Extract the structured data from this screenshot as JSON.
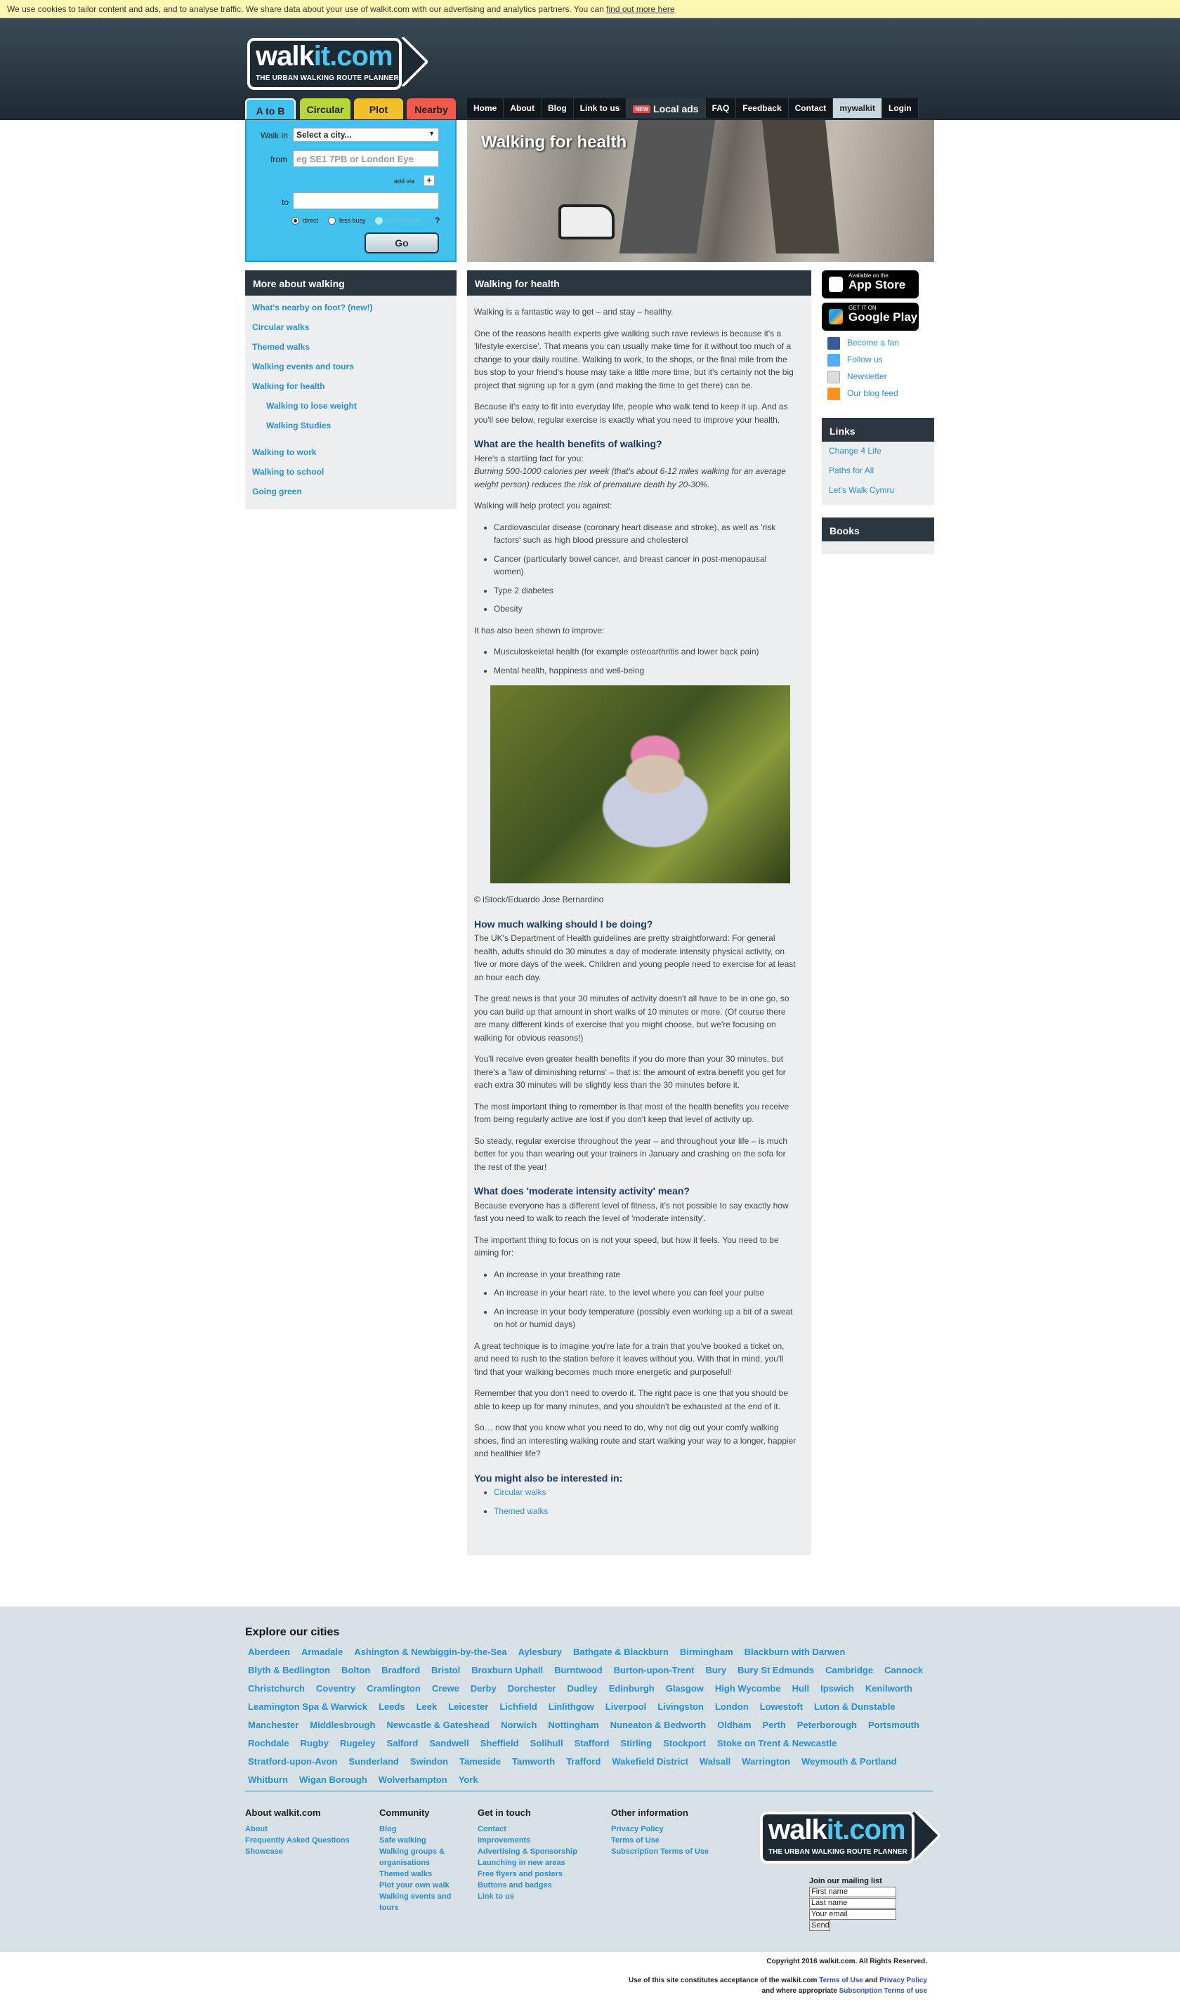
{
  "cookie": {
    "text": "We use cookies to tailor content and ads, and to analyse traffic. We share data about your use of walkit.com with our advertising and analytics partners. You can",
    "link": "find out more here"
  },
  "logo": {
    "walk": "walk",
    "it": "it.com",
    "tagline": "THE URBAN WALKING ROUTE PLANNER"
  },
  "tabs": [
    {
      "label": "A to B",
      "color": "#41c2ef"
    },
    {
      "label": "Circular",
      "color": "#b8d63a"
    },
    {
      "label": "Plot",
      "color": "#f4c02a"
    },
    {
      "label": "Nearby",
      "color": "#f05a4c"
    }
  ],
  "nav": {
    "home": "Home",
    "about": "About",
    "blog": "Blog",
    "link": "Link to us",
    "new_badge": "NEW",
    "local_ads": "Local ads",
    "faq": "FAQ",
    "feedback": "Feedback",
    "contact": "Contact",
    "mywalkit": "mywalkit",
    "login": "Login"
  },
  "planner": {
    "walk_in": "Walk in",
    "city_select": "Select a city...",
    "from": "from",
    "from_placeholder": "eg SE1 7PB or London Eye",
    "add_via": "add via",
    "to": "to",
    "opt_direct": "direct",
    "opt_less_busy": "less busy",
    "opt_low_pollution": "low pollution",
    "help": "?",
    "go": "Go"
  },
  "hero": {
    "title": "Walking for health"
  },
  "left": {
    "heading": "More about walking",
    "items": [
      "What's nearby on foot? (new!)",
      "Circular walks",
      "Themed walks",
      "Walking events and tours",
      "Walking for health"
    ],
    "subitems": [
      "Walking to lose weight",
      "Walking Studies"
    ],
    "items2": [
      "Walking to work",
      "Walking to school",
      "Going green"
    ]
  },
  "article": {
    "heading": "Walking for health",
    "p1": "Walking is a fantastic way to get – and stay – healthy.",
    "p2": "One of the reasons health experts give walking such rave reviews is because it's a 'lifestyle exercise'. That means you can usually make time for it without too much of a change to your daily routine. Walking to work, to the shops, or the final mile from the bus stop to your friend's house may take a little more time, but it's certainly not the big project that signing up for a gym (and making the time to get there) can be.",
    "p3": "Because it's easy to fit into everyday life, people who walk tend to keep it up. And as you'll see below, regular exercise is exactly what you need to improve your health.",
    "h1": "What are the health benefits of walking?",
    "p4a": "Here's a startling fact for you:",
    "p4b": "Burning 500-1000 calories per week (that's about 6-12 miles walking for an average weight person) reduces the risk of premature death by 20-30%.",
    "p5": "Walking will help protect you against:",
    "list1": [
      "Cardiovascular disease (coronary heart disease and stroke), as well as 'risk factors' such as high blood pressure and cholesterol",
      "Cancer (particularly bowel cancer, and breast cancer in post-menopausal women)",
      "Type 2 diabetes",
      "Obesity"
    ],
    "p6": "It has also been shown to improve:",
    "list2": [
      "Musculoskeletal health (for example osteoarthritis and lower back pain)",
      "Mental health, happiness and well-being"
    ],
    "caption": "© iStock/Eduardo Jose Bernardino",
    "h2": "How much walking should I be doing?",
    "p7": "The UK's Department of Health guidelines are pretty straightforward: For general health, adults should do 30 minutes a day of moderate intensity physical activity, on five or more days of the week. Children and young people need to exercise for at least an hour each day.",
    "p8": "The great news is that your 30 minutes of activity doesn't all have to be in one go, so you can build up that amount in short walks of 10 minutes or more. (Of course there are many different kinds of exercise that you might choose, but we're focusing on walking for obvious reasons!)",
    "p9": "You'll receive even greater health benefits if you do more than your 30 minutes, but there's a 'law of diminishing returns' – that is: the amount of extra benefit you get for each extra 30 minutes will be slightly less than the 30 minutes before it.",
    "p10": "The most important thing to remember is that most of the health benefits you receive from being regularly active are lost if you don't keep that level of activity up.",
    "p11": "So steady, regular exercise throughout the year – and throughout your life – is much better for you than wearing out your trainers in January and crashing on the sofa for the rest of the year!",
    "h3": "What does 'moderate intensity activity' mean?",
    "p12": "Because everyone has a different level of fitness, it's not possible to say exactly how fast you need to walk to reach the level of 'moderate intensity'.",
    "p13": "The important thing to focus on is not your speed, but how it feels. You need to be aiming for:",
    "list3": [
      "An increase in your breathing rate",
      "An increase in your heart rate, to the level where you can feel your pulse",
      "An increase in your body temperature (possibly even working up a bit of a sweat on hot or humid days)"
    ],
    "p14": "A great technique is to imagine you're late for a train that you've booked a ticket on, and need to rush to the station before it leaves without you. With that in mind, you'll find that your walking becomes much more energetic and purposeful!",
    "p15": "Remember that you don't need to overdo it. The right pace is one that you should be able to keep up for many minutes, and you shouldn't be exhausted at the end of it.",
    "p16": "So… now that you know what you need to do, why not dig out your comfy walking shoes, find an interesting walking route and start walking your way to a longer, happier and healthier life?",
    "h4": "You might also be interested in:",
    "list4": [
      "Circular walks",
      "Themed walks"
    ]
  },
  "right": {
    "appstore_small": "Available on the",
    "appstore_big": "App Store",
    "play_small": "GET IT ON",
    "play_big": "Google Play",
    "social": [
      "Become a fan",
      "Follow us",
      "Newsletter",
      "Our blog feed"
    ],
    "links_heading": "Links",
    "links": [
      "Change 4 Life",
      "Paths for All",
      "Let's Walk Cymru"
    ],
    "books_heading": "Books"
  },
  "footer": {
    "cities_heading": "Explore our cities",
    "cities": [
      "Aberdeen",
      "Armadale",
      "Ashington & Newbiggin-by-the-Sea",
      "Aylesbury",
      "Bathgate & Blackburn",
      "Birmingham",
      "Blackburn with Darwen",
      "Blyth & Bedlington",
      "Bolton",
      "Bradford",
      "Bristol",
      "Broxburn Uphall",
      "Burntwood",
      "Burton-upon-Trent",
      "Bury",
      "Bury St Edmunds",
      "Cambridge",
      "Cannock",
      "Christchurch",
      "Coventry",
      "Cramlington",
      "Crewe",
      "Derby",
      "Dorchester",
      "Dudley",
      "Edinburgh",
      "Glasgow",
      "High Wycombe",
      "Hull",
      "Ipswich",
      "Kenilworth",
      "Leamington Spa & Warwick",
      "Leeds",
      "Leek",
      "Leicester",
      "Lichfield",
      "Linlithgow",
      "Liverpool",
      "Livingston",
      "London",
      "Lowestoft",
      "Luton & Dunstable",
      "Manchester",
      "Middlesbrough",
      "Newcastle & Gateshead",
      "Norwich",
      "Nottingham",
      "Nuneaton & Bedworth",
      "Oldham",
      "Perth",
      "Peterborough",
      "Portsmouth",
      "Rochdale",
      "Rugby",
      "Rugeley",
      "Salford",
      "Sandwell",
      "Sheffield",
      "Solihull",
      "Stafford",
      "Stirling",
      "Stockport",
      "Stoke on Trent & Newcastle",
      "Stratford-upon-Avon",
      "Sunderland",
      "Swindon",
      "Tameside",
      "Tamworth",
      "Trafford",
      "Wakefield District",
      "Walsall",
      "Warrington",
      "Weymouth & Portland",
      "Whitburn",
      "Wigan Borough",
      "Wolverhampton",
      "York"
    ],
    "about_heading": "About walkit.com",
    "about": [
      "About",
      "Frequently Asked Questions",
      "Showcase"
    ],
    "community_heading": "Community",
    "community": [
      "Blog",
      "Safe walking",
      "Walking groups & organisations",
      "Themed walks",
      "Plot your own walk",
      "Walking events and tours"
    ],
    "touch_heading": "Get in touch",
    "touch": [
      "Contact",
      "Improvements",
      "Advertising & Sponsorship",
      "Launching in new areas",
      "Free flyers and posters",
      "Buttons and badges",
      "Link to us"
    ],
    "other_heading": "Other information",
    "other": [
      "Privacy Policy",
      "Terms of Use",
      "Subscription Terms of Use"
    ],
    "mailing_heading": "Join our mailing list",
    "first": "First name",
    "last": "Last name",
    "email": "Your email",
    "send": "Send",
    "copyright": "Copyright 2016 walkit.com. All Rights Reserved.",
    "terms1": "Use of this site constitutes acceptance of the walkit.com",
    "terms_link": "Terms of Use",
    "and": "and",
    "privacy_link": "Privacy Policy",
    "terms2": "and where appropriate",
    "sub_link": "Subscription Terms of use"
  }
}
